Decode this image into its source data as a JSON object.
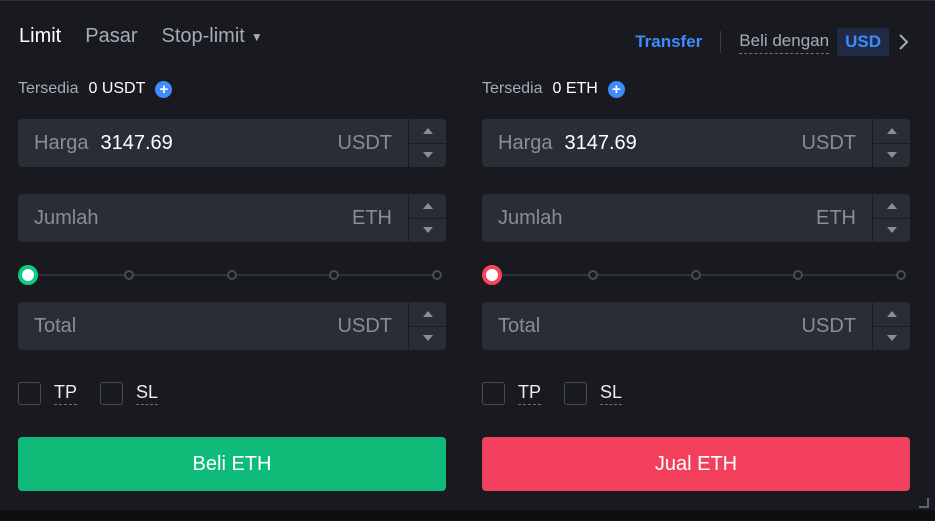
{
  "header": {
    "tabs": [
      {
        "label": "Limit",
        "active": true
      },
      {
        "label": "Pasar",
        "active": false
      },
      {
        "label": "Stop-limit",
        "active": false
      }
    ],
    "transfer_label": "Transfer",
    "buy_with_label": "Beli dengan",
    "currency": "USD"
  },
  "buy": {
    "available_label": "Tersedia",
    "available_value": "0 USDT",
    "price": {
      "label": "Harga",
      "value": "3147.69",
      "unit": "USDT"
    },
    "amount": {
      "label": "Jumlah",
      "value": "",
      "unit": "ETH"
    },
    "slider_percent": 0,
    "total": {
      "label": "Total",
      "value": "",
      "unit": "USDT"
    },
    "tp_label": "TP",
    "sl_label": "SL",
    "button_label": "Beli ETH"
  },
  "sell": {
    "available_label": "Tersedia",
    "available_value": "0 ETH",
    "price": {
      "label": "Harga",
      "value": "3147.69",
      "unit": "USDT"
    },
    "amount": {
      "label": "Jumlah",
      "value": "",
      "unit": "ETH"
    },
    "slider_percent": 0,
    "total": {
      "label": "Total",
      "value": "",
      "unit": "USDT"
    },
    "tp_label": "TP",
    "sl_label": "SL",
    "button_label": "Jual ETH"
  },
  "colors": {
    "buy": "#0ebb79",
    "sell": "#f23f5c",
    "accent": "#3d8bfd",
    "background": "#181a20",
    "field": "#2a2d35"
  },
  "icons": {
    "add": "plus-circle-icon",
    "dropdown": "caret-down-icon",
    "next": "chevron-right-icon",
    "stepper_up": "triangle-up-icon",
    "stepper_down": "triangle-down-icon"
  }
}
